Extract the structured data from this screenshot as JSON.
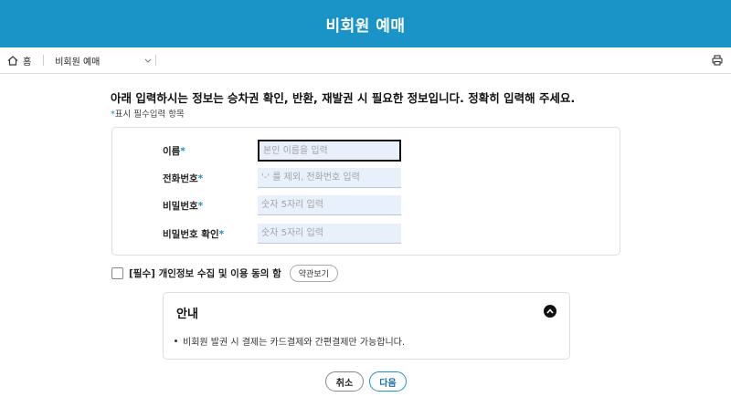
{
  "header": {
    "title": "비회원 예매"
  },
  "breadcrumb": {
    "home": "홈",
    "current": "비회원 예매"
  },
  "intro": {
    "text": "아래 입력하시는 정보는 승차권 확인, 반환, 재발권 시 필요한 정보입니다. 정확히 입력해 주세요.",
    "required_mark": "*",
    "required_note": "표시 필수입력 항목"
  },
  "form": {
    "name": {
      "label": "이름",
      "placeholder": "본인 이름을 입력"
    },
    "phone": {
      "label": "전화번호",
      "placeholder": "'-' 를 제외, 전화번호 입력"
    },
    "password": {
      "label": "비밀번호",
      "placeholder": "숫자 5자리 입력"
    },
    "password_confirm": {
      "label": "비밀번호 확인",
      "placeholder": "숫자 5자리 입력"
    }
  },
  "agreement": {
    "label": "[필수] 개인정보 수집 및 이용 동의 함",
    "terms_button": "약관보기"
  },
  "info": {
    "title": "안내",
    "item": "비회원 발권 시 결제는 카드결제와 간편결제만 가능합니다."
  },
  "buttons": {
    "cancel": "취소",
    "next": "다음"
  },
  "colors": {
    "accent": "#1a94c7",
    "header_bg": "#1a94c7",
    "input_bg": "#e8f0fc"
  },
  "icons": {
    "home": "home-icon",
    "dropdown": "chevron-down-icon",
    "print": "printer-icon",
    "collapse": "chevron-up-icon"
  }
}
